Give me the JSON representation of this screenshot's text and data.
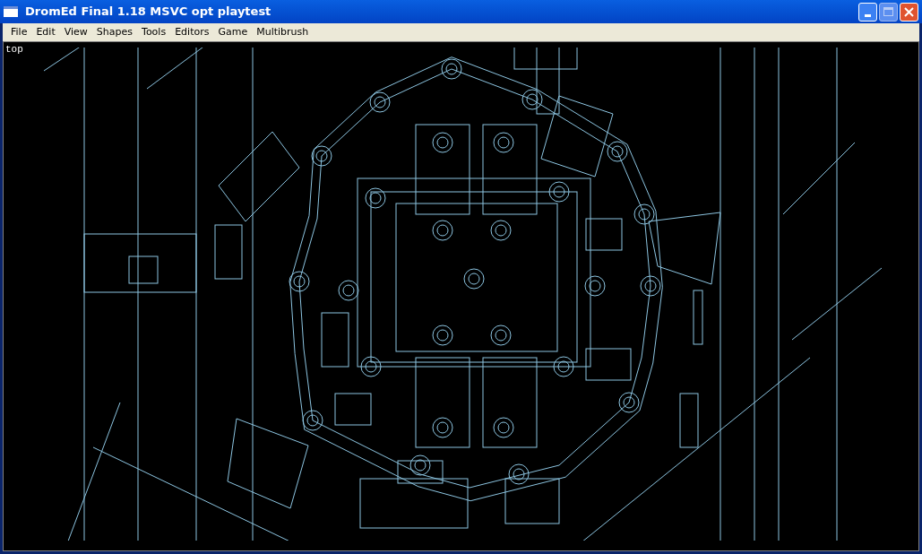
{
  "window": {
    "title": "DromEd Final 1.18 MSVC opt playtest"
  },
  "menu": [
    "File",
    "Edit",
    "View",
    "Shapes",
    "Tools",
    "Editors",
    "Game",
    "Multibrush"
  ],
  "viewport": {
    "label": "top"
  }
}
